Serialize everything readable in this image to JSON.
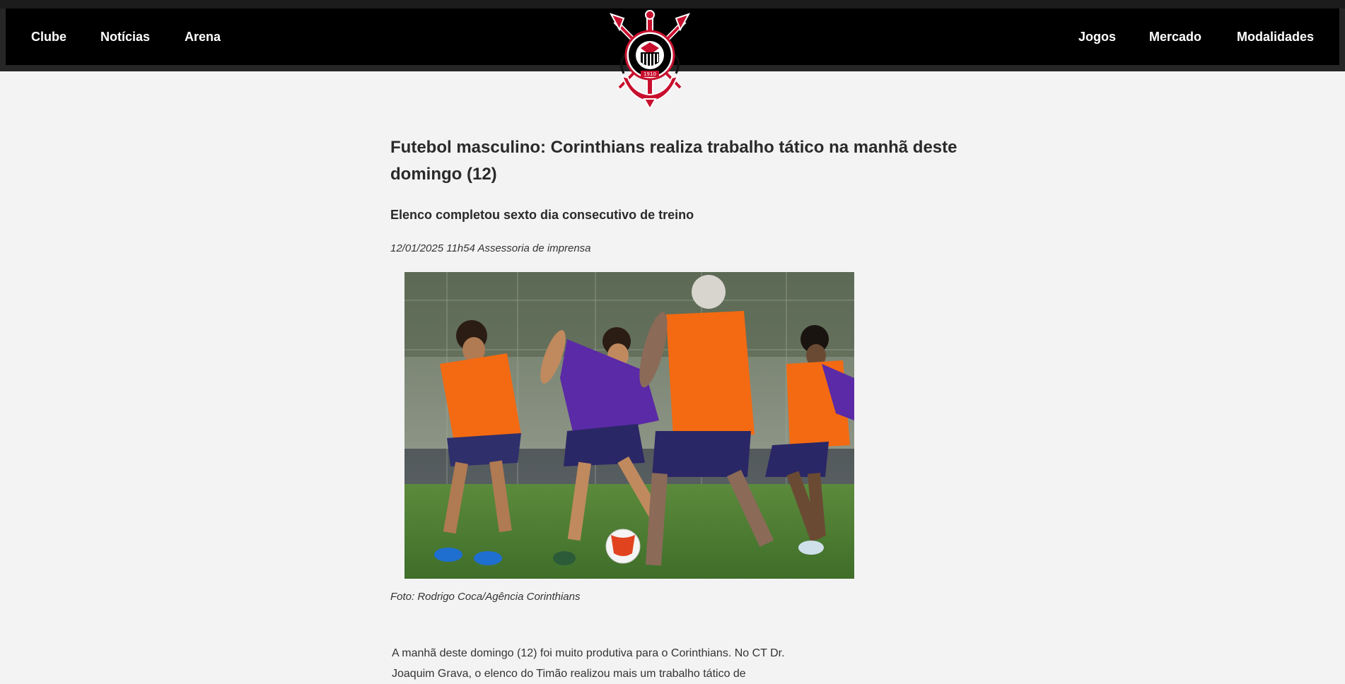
{
  "nav": {
    "left": [
      "Clube",
      "Notícias",
      "Arena"
    ],
    "right": [
      "Jogos",
      "Mercado",
      "Modalidades"
    ]
  },
  "logo": {
    "text": "SPORT CLUB CORINTHIANS PAULISTA",
    "year": "1910"
  },
  "article": {
    "title": "Futebol masculino: Corinthians realiza trabalho tático na manhã deste domingo (12)",
    "subtitle": "Elenco completou sexto dia consecutivo de treino",
    "meta": "12/01/2025 11h54 Assessoria de imprensa",
    "caption": "Foto: Rodrigo Coca/Agência Corinthians",
    "body": "A manhã deste domingo (12) foi muito produtiva para o Corinthians. No CT Dr. Joaquim Grava, o elenco do Timão realizou mais um trabalho tático de"
  },
  "colors": {
    "nav_bg": "#000000",
    "page_bg": "#f3f3f3",
    "bib": "#f36a12",
    "kit": "#5b2aa6"
  }
}
